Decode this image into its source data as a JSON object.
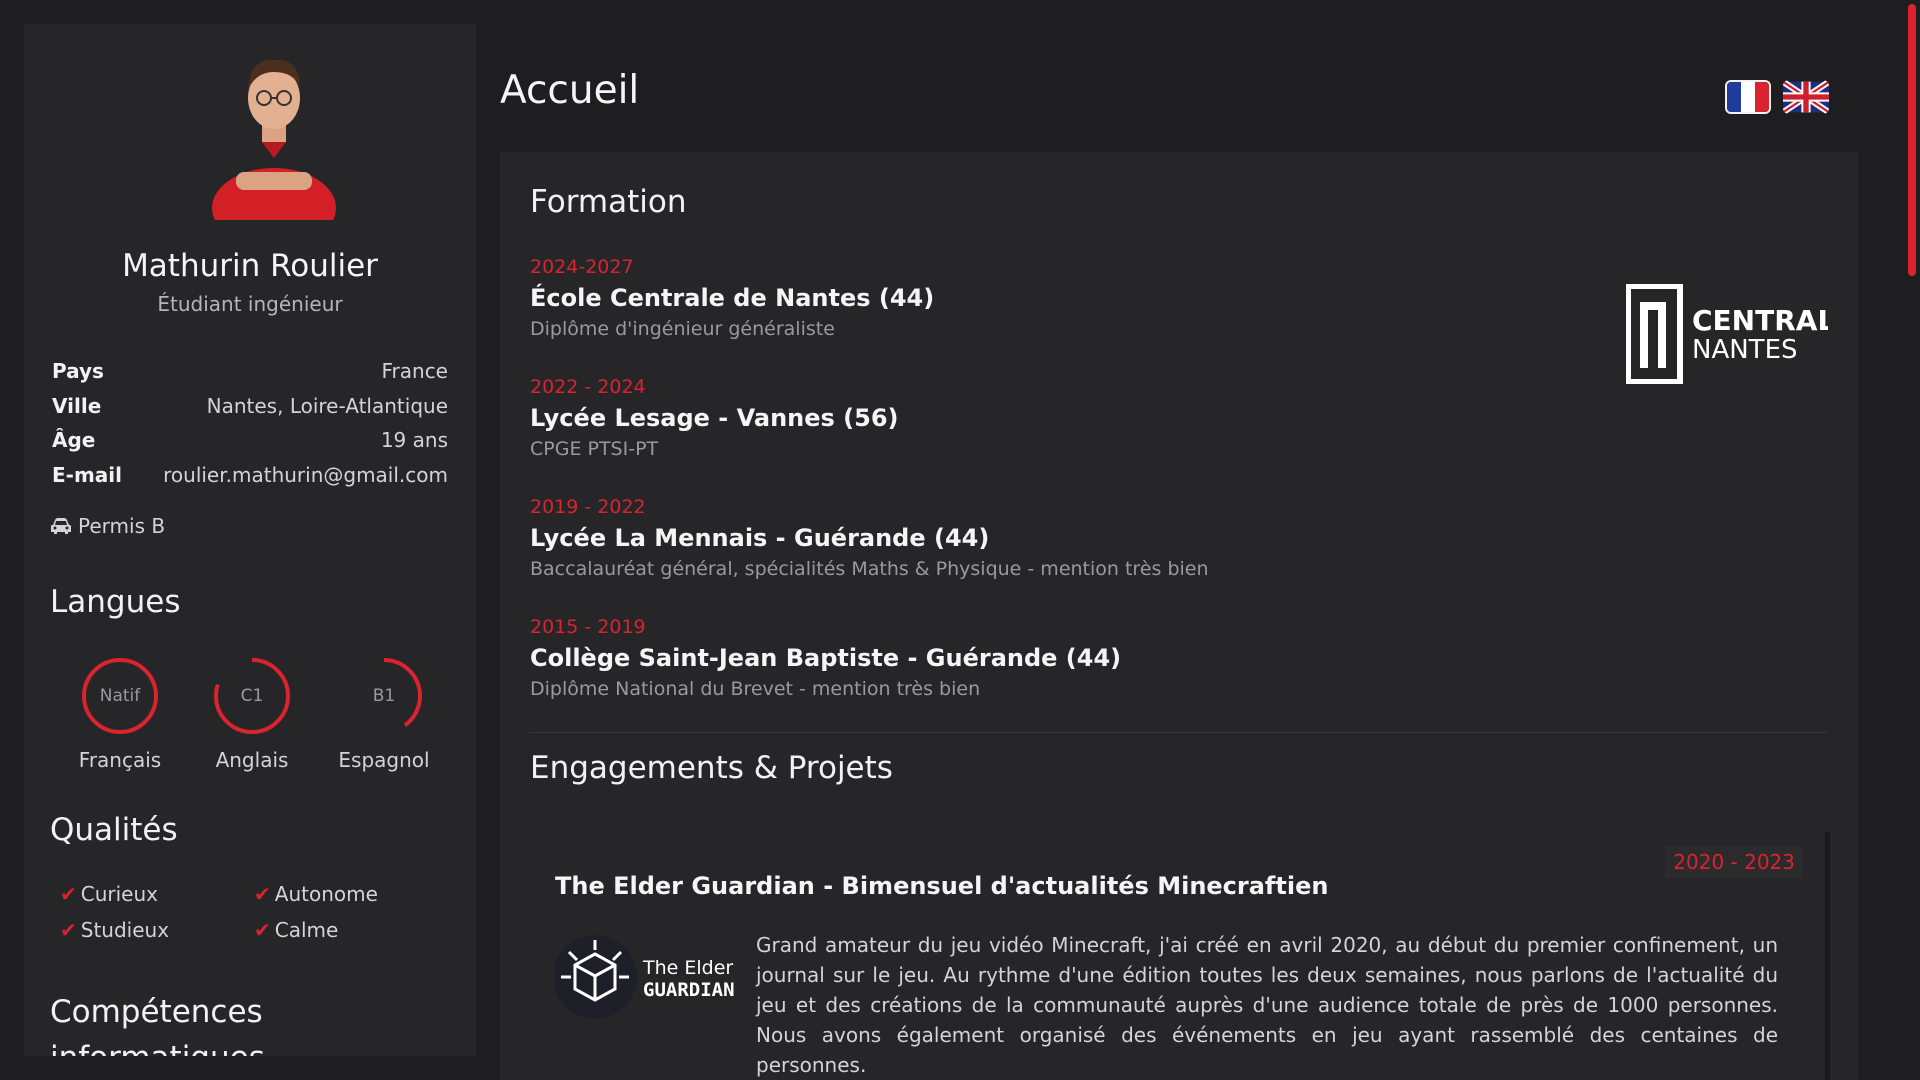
{
  "profile": {
    "name": "Mathurin Roulier",
    "subtitle": "Étudiant ingénieur",
    "info": [
      {
        "label": "Pays",
        "value": "France"
      },
      {
        "label": "Ville",
        "value": "Nantes, Loire-Atlantique"
      },
      {
        "label": "Âge",
        "value": "19 ans"
      },
      {
        "label": "E-mail",
        "value": "roulier.mathurin@gmail.com"
      }
    ],
    "permis": "Permis B"
  },
  "langues": {
    "title": "Langues",
    "items": [
      {
        "name": "Français",
        "level": "Natif",
        "fraction": 1.0
      },
      {
        "name": "Anglais",
        "level": "C1",
        "fraction": 0.8
      },
      {
        "name": "Espagnol",
        "level": "B1",
        "fraction": 0.4
      }
    ]
  },
  "qualites": {
    "title": "Qualités",
    "items": [
      "Curieux",
      "Autonome",
      "Studieux",
      "Calme"
    ]
  },
  "competences": {
    "title_line1": "Compétences",
    "title_line2": "informatiques"
  },
  "page_title": "Accueil",
  "formation": {
    "title": "Formation",
    "items": [
      {
        "years": "2024-2027",
        "school": "École Centrale de Nantes (44)",
        "detail": "Diplôme d'ingénieur généraliste"
      },
      {
        "years": "2022 - 2024",
        "school": "Lycée Lesage - Vannes (56)",
        "detail": "CPGE PTSI-PT"
      },
      {
        "years": "2019 - 2022",
        "school": "Lycée La Mennais - Guérande (44)",
        "detail": "Baccalauréat général, spécialités Maths & Physique - mention très bien"
      },
      {
        "years": "2015 - 2019",
        "school": "Collège Saint-Jean Baptiste - Guérande (44)",
        "detail": "Diplôme National du Brevet - mention très bien"
      }
    ],
    "logo_line1": "CENTRALE",
    "logo_line2": "NANTES"
  },
  "engagements": {
    "title": "Engagements & Projets",
    "project": {
      "title": "The Elder Guardian - Bimensuel d'actualités Minecraftien",
      "years": "2020 - 2023",
      "logo_line1": "The Elder",
      "logo_line2": "GUARDIAN",
      "text": "Grand amateur du jeu vidéo Minecraft, j'ai créé en avril 2020, au début du premier confinement, un journal sur le jeu. Au rythme d'une édition toutes les deux semaines, nous parlons de l'actualité du jeu et des créations de la communauté auprès d'une audience totale de près de 1000 personnes. Nous avons également organisé des événements en jeu ayant rassemblé des centaines de personnes."
    }
  },
  "colors": {
    "accent": "#d9232e",
    "background": "#1e1e21",
    "panel": "#262629"
  },
  "icons": [
    "car-icon",
    "check-icon",
    "flag-fr-icon",
    "flag-uk-icon"
  ]
}
